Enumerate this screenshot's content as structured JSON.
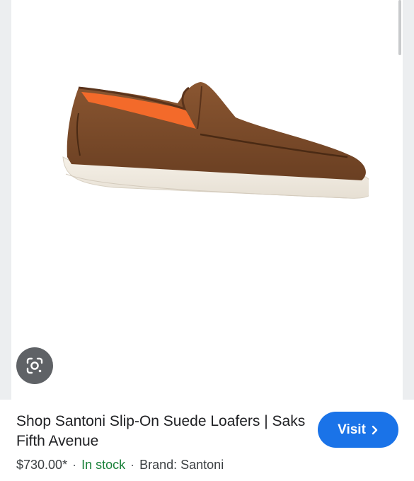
{
  "product": {
    "title": "Shop Santoni Slip-On Suede Loafers | Saks Fifth Avenue",
    "price": "$730.00*",
    "stock": "In stock",
    "brand": "Brand: Santoni",
    "separator": "·",
    "image_alt": "Santoni slip-on suede loafer"
  },
  "actions": {
    "visit_label": "Visit"
  },
  "icons": {
    "lens": "google-lens-icon",
    "chevron": "chevron-right-icon"
  },
  "colors": {
    "visit_bg": "#1a73e8",
    "in_stock": "#188038",
    "lens_bg": "#5f6266"
  }
}
